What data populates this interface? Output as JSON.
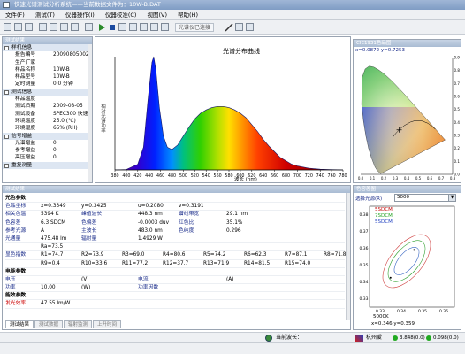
{
  "window": {
    "title": "快速光谱测试分析系统——当前数据文件为：10W-B.DAT"
  },
  "menu": [
    "文件(F)",
    "测试(T)",
    "仪器操作(I)",
    "仪器校准(C)",
    "视图(V)",
    "帮助(H)"
  ],
  "toolbar": {
    "status_label": "光谱仪已连接"
  },
  "tree": {
    "title": "测试结果",
    "rows": [
      {
        "k": "样机信息",
        "v": "",
        "sec": true
      },
      {
        "k": "报告编号",
        "v": "20090805002"
      },
      {
        "k": "生产厂家",
        "v": ""
      },
      {
        "k": "样品名称",
        "v": "10W-B"
      },
      {
        "k": "样品型号",
        "v": "10W-B"
      },
      {
        "k": "定时测量",
        "v": "0.0  分钟"
      },
      {
        "k": "测试信息",
        "v": "",
        "sec": true
      },
      {
        "k": "样品温度",
        "v": ""
      },
      {
        "k": "测试日期",
        "v": "2009-08-05"
      },
      {
        "k": "测试设备",
        "v": "SPEC300 快速"
      },
      {
        "k": "环境温度",
        "v": "25.0  (℃)"
      },
      {
        "k": "环境湿度",
        "v": "65%  (RH)"
      },
      {
        "k": "信号增益",
        "v": "",
        "sec": true
      },
      {
        "k": "光谱增益",
        "v": "0"
      },
      {
        "k": "参考增益",
        "v": "0"
      },
      {
        "k": "高压增益",
        "v": "0"
      },
      {
        "k": "重复测量",
        "v": "",
        "sec": true
      }
    ]
  },
  "spectrum": {
    "header": "光谱分析"
  },
  "cie_panel": {
    "header": "CIE1931色品图",
    "readout": "x=0.0872  y=0.7253"
  },
  "results": {
    "title": "测试结果",
    "section_color": "光色参数",
    "rows": [
      [
        [
          "色品坐标",
          "lblblue"
        ],
        [
          "x=0.3349",
          "v"
        ],
        [
          "y=0.3425",
          "v"
        ],
        [
          "u=0.2080",
          "v"
        ],
        [
          "v=0.3191",
          "v"
        ]
      ],
      [
        [
          "相关色温",
          "lblblue"
        ],
        [
          "5394 K",
          "v"
        ],
        [
          "峰值波长",
          "lblblue"
        ],
        [
          "448.3 nm",
          "v"
        ],
        [
          "谱线带宽",
          "lblblue"
        ],
        [
          "29.1 nm",
          "v"
        ]
      ],
      [
        [
          "色容差",
          "lblblue"
        ],
        [
          "6.3 SDCM",
          "v"
        ],
        [
          "色偏差",
          "lblblue"
        ],
        [
          "-0.0003 duv",
          "v"
        ],
        [
          "红色比",
          "lblblue"
        ],
        [
          "35.1%",
          "v"
        ]
      ],
      [
        [
          "参考光源",
          "lblblue"
        ],
        [
          "A",
          "v"
        ],
        [
          "主波长",
          "lblblue"
        ],
        [
          "483.0 nm",
          "v"
        ],
        [
          "色纯度",
          "lblblue"
        ],
        [
          "0.296",
          "v"
        ]
      ],
      [
        [
          "光通量",
          "lblblue"
        ],
        [
          "475.48  lm",
          "v"
        ],
        [
          "辐射量",
          "lblblue"
        ],
        [
          "1.4929 W",
          "v"
        ]
      ]
    ],
    "ra_row0": "Ra=73.5",
    "cri_label": "显色指数",
    "cri_rows": [
      [
        "R1=74.7",
        "R2=73.9",
        "R3=69.0",
        "R4=80.6",
        "R5=74.2",
        "R6=62.3",
        "R7=87.1",
        "R8=71.8"
      ],
      [
        "R9=0.4",
        "R10=33.6",
        "R11=77.2",
        "R12=37.7",
        "R13=71.9",
        "R14=81.5",
        "R15=74.0"
      ]
    ],
    "section_elec": "电能参数",
    "elec_rows": [
      [
        [
          "电压",
          "lblblue"
        ],
        [
          "",
          "v"
        ],
        [
          "(V)",
          "v"
        ],
        [
          "电流",
          "lblblue"
        ],
        [
          "",
          "v"
        ],
        [
          "(A)",
          "v"
        ]
      ],
      [
        [
          "功率",
          "lblblue"
        ],
        [
          "10.00",
          "v"
        ],
        [
          "(W)",
          "v"
        ],
        [
          "功率因数",
          "lblblue"
        ],
        [
          "",
          "v"
        ]
      ]
    ],
    "section_eff": "能效参数",
    "eff_label": "发光效率",
    "eff_value": "47.55 lm/W",
    "tabs": [
      "测试结果",
      "测试数据",
      "辐射监测",
      "上升时间"
    ]
  },
  "tol_panel": {
    "header": "色容差图",
    "label": "选择光源(R)",
    "select_value": "5000",
    "legend": [
      "5SDCM",
      "7SDCM",
      "5SDCM"
    ],
    "footer_name": "5000K",
    "footer_coords": "x=0.346   y=0.359"
  },
  "statusbar": {
    "wavelength_label": "当前波长：",
    "brand": "杭州爱",
    "value1": "3.848(0.0)",
    "value2": "0.098(0.0)"
  },
  "chart_data": [
    {
      "type": "line",
      "title": "光谱分布曲线",
      "xlabel": "波长 (nm)",
      "ylabel": "相对光谱功率",
      "xlim": [
        380,
        780
      ],
      "ylim": [
        0,
        1
      ],
      "x": [
        380,
        400,
        420,
        430,
        438,
        445,
        448,
        452,
        458,
        465,
        472,
        480,
        490,
        500,
        510,
        520,
        530,
        540,
        550,
        560,
        570,
        580,
        590,
        600,
        610,
        620,
        630,
        640,
        650,
        660,
        670,
        680,
        690,
        700,
        720,
        740,
        760,
        780
      ],
      "y": [
        0.0,
        0.004,
        0.05,
        0.2,
        0.62,
        0.95,
        1.0,
        0.88,
        0.55,
        0.3,
        0.2,
        0.18,
        0.22,
        0.3,
        0.38,
        0.45,
        0.5,
        0.53,
        0.55,
        0.56,
        0.56,
        0.55,
        0.53,
        0.5,
        0.46,
        0.4,
        0.34,
        0.27,
        0.21,
        0.16,
        0.11,
        0.08,
        0.05,
        0.035,
        0.015,
        0.006,
        0.002,
        0.0
      ],
      "xticks": [
        "380",
        "400",
        "420",
        "440",
        "460",
        "480",
        "500",
        "520",
        "540",
        "560",
        "580",
        "600",
        "620",
        "640",
        "660",
        "680",
        "700",
        "720",
        "740",
        "760",
        "780"
      ],
      "grid": false
    },
    {
      "type": "scatter",
      "title": "CIE1931色品图",
      "xlim": [
        0,
        0.8
      ],
      "ylim": [
        0,
        0.9
      ],
      "xticks": [
        "0.0",
        "0.1",
        "0.2",
        "0.3",
        "0.4",
        "0.5",
        "0.6",
        "0.7",
        "0.8"
      ],
      "yticks": [
        "0.0",
        "0.1",
        "0.2",
        "0.3",
        "0.4",
        "0.5",
        "0.6",
        "0.7",
        "0.8",
        "0.9"
      ],
      "points": [
        {
          "x": 0.3349,
          "y": 0.3425
        }
      ],
      "grid": false
    },
    {
      "type": "scatter",
      "title": "色容差",
      "xlim": [
        0.325,
        0.365
      ],
      "ylim": [
        0.325,
        0.385
      ],
      "xticks": [
        "0.33",
        "0.34",
        "0.35",
        "0.36"
      ],
      "yticks": [
        "0.33",
        "0.34",
        "0.35",
        "0.36",
        "0.37",
        "0.38"
      ],
      "points": [
        {
          "x": 0.3349,
          "y": 0.3425
        },
        {
          "x": 0.346,
          "y": 0.359
        }
      ]
    }
  ],
  "colors": {
    "titlebar": "#8aa6cc",
    "panel_header": "#b6c6dc",
    "accent_red": "#cc0000",
    "label_blue": "#1a2c8a"
  }
}
